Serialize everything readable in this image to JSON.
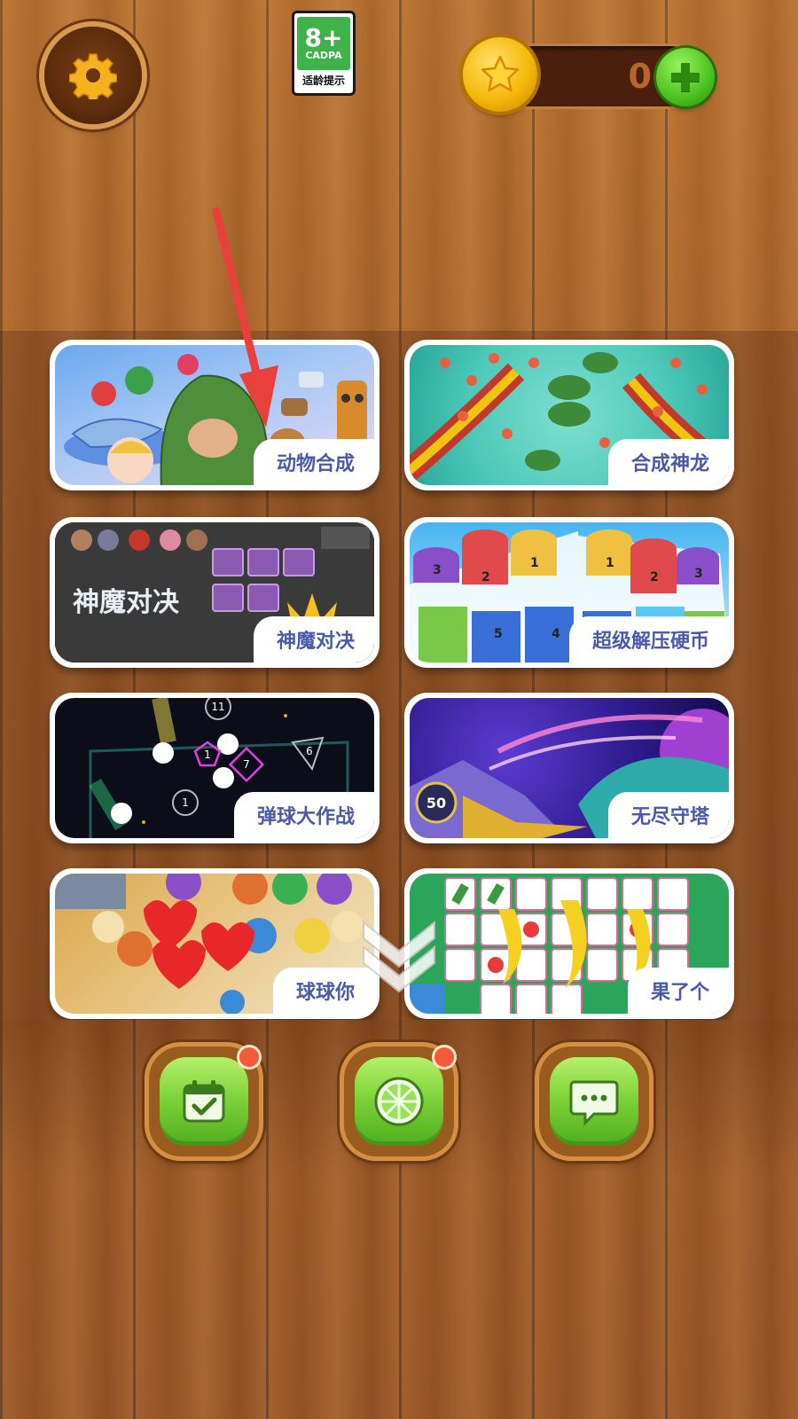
{
  "header": {
    "age_rating": {
      "rating": "8+",
      "org": "CADPA",
      "hint": "适龄提示"
    },
    "coins": {
      "count": "0"
    }
  },
  "games": [
    {
      "label": "动物合成"
    },
    {
      "label": "合成神龙"
    },
    {
      "label": "神魔对决",
      "art_title": "神魔对决"
    },
    {
      "label": "超级解压硬币"
    },
    {
      "label": "弹球大作战"
    },
    {
      "label": "无尽守塔",
      "art_number": "50"
    },
    {
      "label": "球球你"
    },
    {
      "label": "果了个"
    }
  ],
  "pinball_numbers": [
    "11",
    "7",
    "1",
    "6",
    "1"
  ],
  "coin_stack_numbers": [
    "3",
    "2",
    "1",
    "1",
    "2",
    "3",
    "5",
    "4"
  ],
  "colors": {
    "accent_green": "#4cc21f",
    "label_text": "#4a5aa8",
    "wood": "#a8612a",
    "notification": "#f25a3a"
  },
  "bottom_nav": [
    {
      "name": "calendar-check-icon",
      "has_notification": true
    },
    {
      "name": "lime-slice-icon",
      "has_notification": true
    },
    {
      "name": "chat-bubble-icon",
      "has_notification": false
    }
  ]
}
